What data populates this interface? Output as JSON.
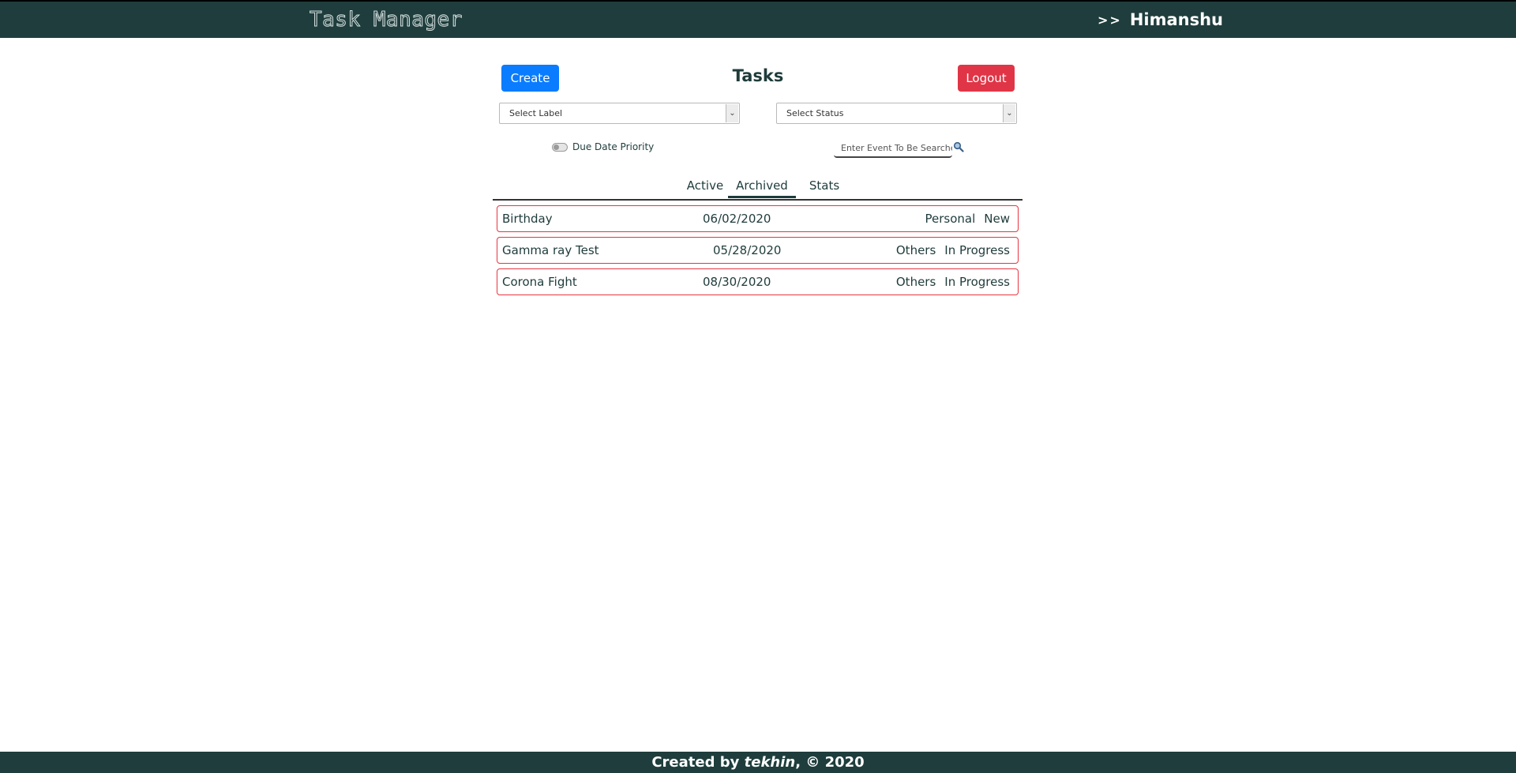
{
  "header": {
    "brand": "Task Manager",
    "user_prefix": ">>",
    "user_name": "Himanshu"
  },
  "toolbar": {
    "create_label": "Create",
    "title": "Tasks",
    "logout_label": "Logout"
  },
  "filters": {
    "label_select": "Select Label",
    "status_select": "Select Status",
    "priority_toggle_label": "Due Date Priority",
    "priority_toggle_on": false,
    "search_placeholder": "Enter Event To Be Searched"
  },
  "tabs": [
    {
      "label": "Active",
      "selected": false
    },
    {
      "label": "Archived",
      "selected": true
    },
    {
      "label": "Stats",
      "selected": false
    }
  ],
  "tasks": [
    {
      "name": "Birthday",
      "date": "06/02/2020",
      "label": "Personal",
      "status": "New"
    },
    {
      "name": "Gamma ray Test",
      "date": "05/28/2020",
      "label": "Others",
      "status": "In Progress"
    },
    {
      "name": "Corona Fight",
      "date": "08/30/2020",
      "label": "Others",
      "status": "In Progress"
    }
  ],
  "footer": {
    "prefix": "Created by",
    "author": "tekhin",
    "suffix": ", © 2020"
  },
  "colors": {
    "header_bg": "#1f3d3d",
    "create_button": "#0a7cff",
    "logout_button": "#e03546",
    "row_border": "#e8343f"
  }
}
